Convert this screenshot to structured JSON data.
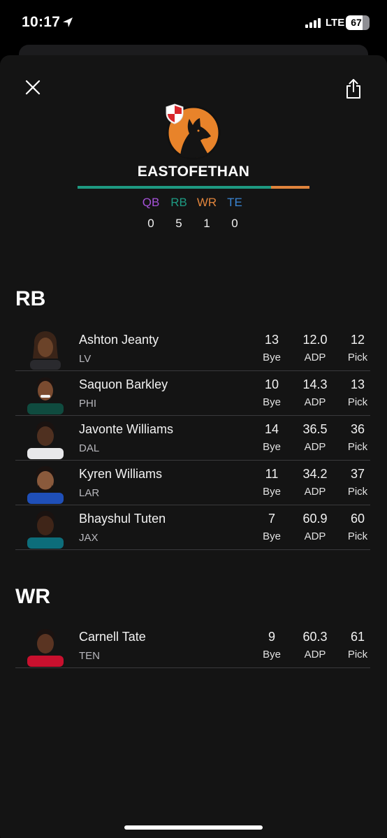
{
  "status_bar": {
    "time": "10:17",
    "network": "LTE",
    "battery": "67"
  },
  "team": {
    "name": "EASTOFETHAN",
    "avatar_icon": "wolf-logo",
    "badge_icon": "shield-badge-icon"
  },
  "positions": [
    {
      "label": "QB",
      "count": "0",
      "color": "#a552d8"
    },
    {
      "label": "RB",
      "count": "5",
      "color": "#1e9a82"
    },
    {
      "label": "WR",
      "count": "1",
      "color": "#e0843c"
    },
    {
      "label": "TE",
      "count": "0",
      "color": "#3a86d4"
    }
  ],
  "sections": {
    "rb": {
      "title": "RB",
      "players": [
        {
          "name": "Ashton Jeanty",
          "team": "LV",
          "bye": "13",
          "adp": "12.0",
          "pick": "12"
        },
        {
          "name": "Saquon Barkley",
          "team": "PHI",
          "bye": "10",
          "adp": "14.3",
          "pick": "13"
        },
        {
          "name": "Javonte Williams",
          "team": "DAL",
          "bye": "14",
          "adp": "36.5",
          "pick": "36"
        },
        {
          "name": "Kyren Williams",
          "team": "LAR",
          "bye": "11",
          "adp": "34.2",
          "pick": "37"
        },
        {
          "name": "Bhayshul Tuten",
          "team": "JAX",
          "bye": "7",
          "adp": "60.9",
          "pick": "60"
        }
      ]
    },
    "wr": {
      "title": "WR",
      "players": [
        {
          "name": "Carnell Tate",
          "team": "TEN",
          "bye": "9",
          "adp": "60.3",
          "pick": "61"
        }
      ]
    }
  },
  "labels": {
    "bye": "Bye",
    "adp": "ADP",
    "pick": "Pick"
  }
}
